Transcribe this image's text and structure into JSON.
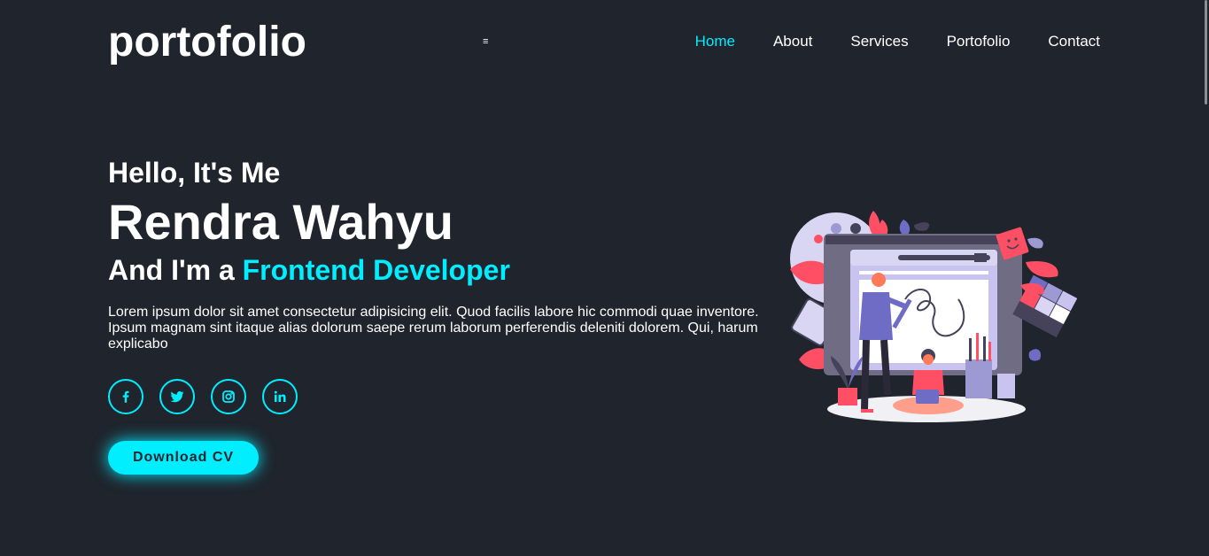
{
  "header": {
    "logo": "portofolio",
    "menu_toggle": "≡",
    "nav": [
      {
        "label": "Home",
        "active": true
      },
      {
        "label": "About",
        "active": false
      },
      {
        "label": "Services",
        "active": false
      },
      {
        "label": "Portofolio",
        "active": false
      },
      {
        "label": "Contact",
        "active": false
      }
    ]
  },
  "hero": {
    "greeting": "Hello, It's Me",
    "name": "Rendra Wahyu",
    "role_prefix": "And I'm a ",
    "role_highlight": "Frontend Developer",
    "description": "Lorem ipsum dolor sit amet consectetur adipisicing elit. Quod facilis labore hic commodi quae inventore. Ipsum magnam sint itaque alias dolorum saepe rerum laborum perferendis deleniti dolorem. Qui, harum explicabo",
    "socials": [
      {
        "icon": "facebook-icon"
      },
      {
        "icon": "twitter-icon"
      },
      {
        "icon": "instagram-icon"
      },
      {
        "icon": "linkedin-icon"
      }
    ],
    "cta_label": "Download CV"
  },
  "colors": {
    "background": "#1f242d",
    "accent": "#00eeff",
    "text": "#ffffff"
  }
}
